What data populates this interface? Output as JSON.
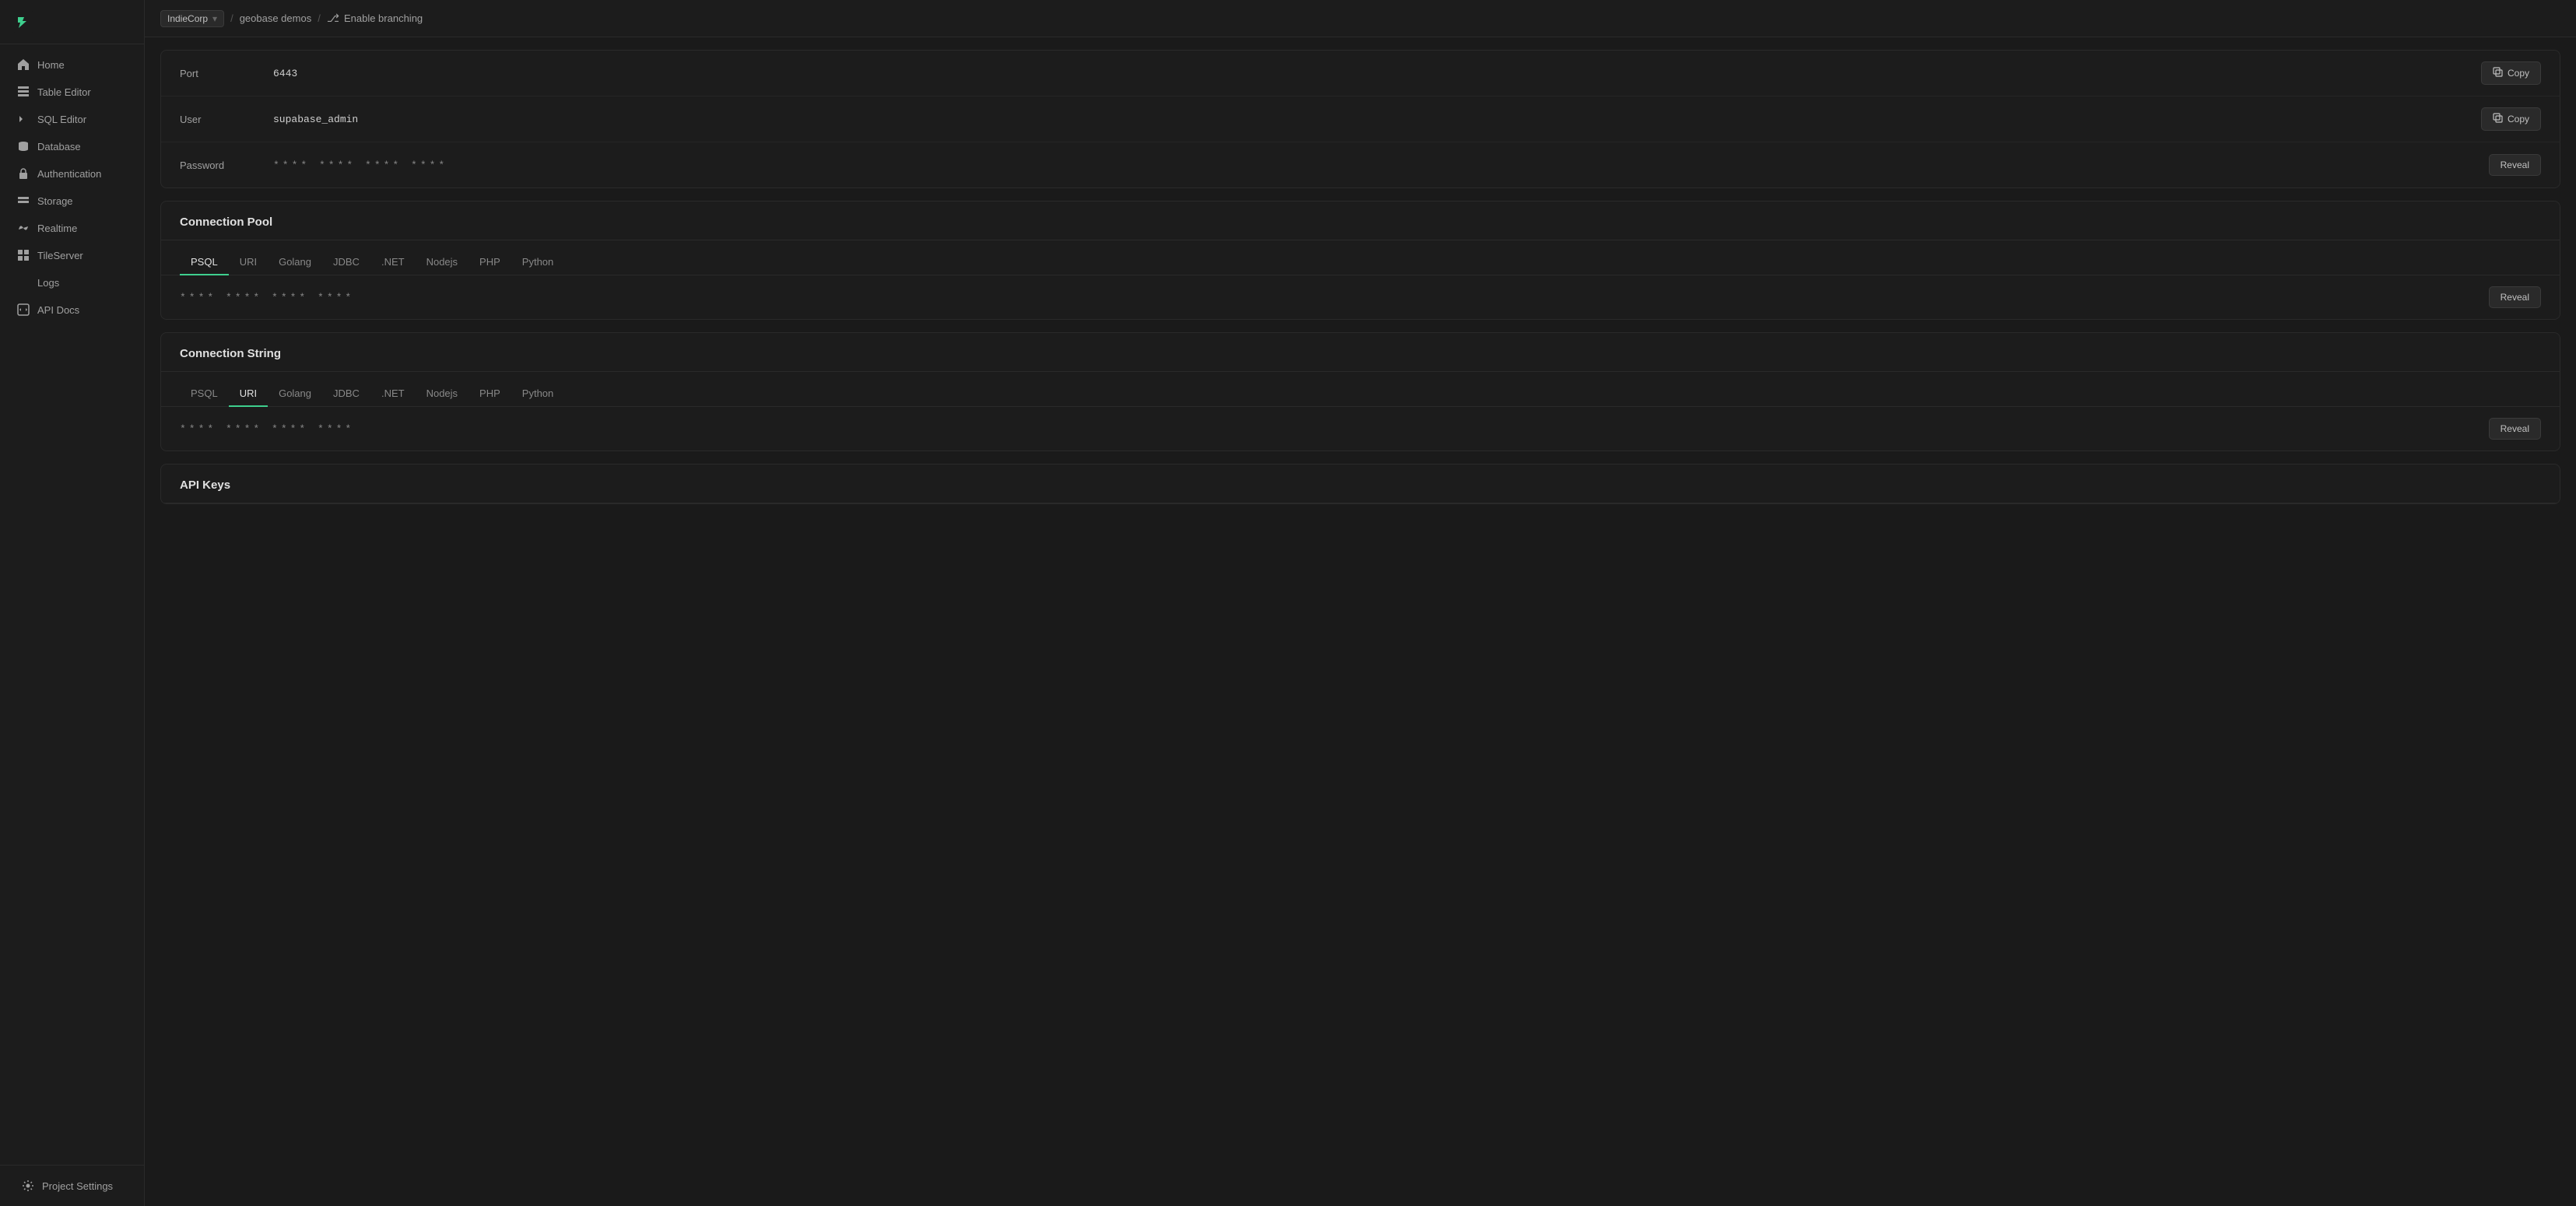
{
  "sidebar": {
    "logo_text": "S",
    "items": [
      {
        "id": "home",
        "label": "Home",
        "icon": "home-icon"
      },
      {
        "id": "table-editor",
        "label": "Table Editor",
        "icon": "table-icon"
      },
      {
        "id": "sql-editor",
        "label": "SQL Editor",
        "icon": "sql-icon"
      },
      {
        "id": "database",
        "label": "Database",
        "icon": "database-icon"
      },
      {
        "id": "authentication",
        "label": "Authentication",
        "icon": "auth-icon"
      },
      {
        "id": "storage",
        "label": "Storage",
        "icon": "storage-icon"
      },
      {
        "id": "realtime",
        "label": "Realtime",
        "icon": "realtime-icon"
      },
      {
        "id": "tileserver",
        "label": "TileServer",
        "icon": "tile-icon"
      },
      {
        "id": "logs",
        "label": "Logs",
        "icon": "logs-icon"
      },
      {
        "id": "api-docs",
        "label": "API Docs",
        "icon": "api-icon"
      }
    ],
    "bottom": {
      "label": "Project Settings",
      "icon": "settings-icon"
    }
  },
  "topbar": {
    "project_name": "IndieСorp",
    "project_status": "active",
    "breadcrumb_sep": "/",
    "project_sub": "geobase demos",
    "enable_branching_label": "Enable branching"
  },
  "connection_pool": {
    "title": "Connection Pool",
    "tabs": [
      "PSQL",
      "URI",
      "Golang",
      "JDBC",
      ".NET",
      "Nodejs",
      "PHP",
      "Python"
    ],
    "active_tab": "PSQL",
    "masked_value": "**** **** **** ****",
    "reveal_label": "Reveal"
  },
  "connection_string": {
    "title": "Connection String",
    "tabs": [
      "PSQL",
      "URI",
      "Golang",
      "JDBC",
      ".NET",
      "Nodejs",
      "PHP",
      "Python"
    ],
    "active_tab": "URI",
    "masked_value": "**** **** **** ****",
    "reveal_label": "Reveal"
  },
  "api_keys": {
    "title": "API Keys"
  },
  "fields": {
    "port": {
      "label": "Port",
      "value": "6443",
      "copy_label": "Copy"
    },
    "user": {
      "label": "User",
      "value": "supabase_admin",
      "copy_label": "Copy"
    },
    "password": {
      "label": "Password",
      "masked": "**** **** **** ****",
      "reveal_label": "Reveal"
    }
  },
  "icons": {
    "copy": "⧉",
    "branch": "⎇",
    "chevron_down": "▾"
  }
}
